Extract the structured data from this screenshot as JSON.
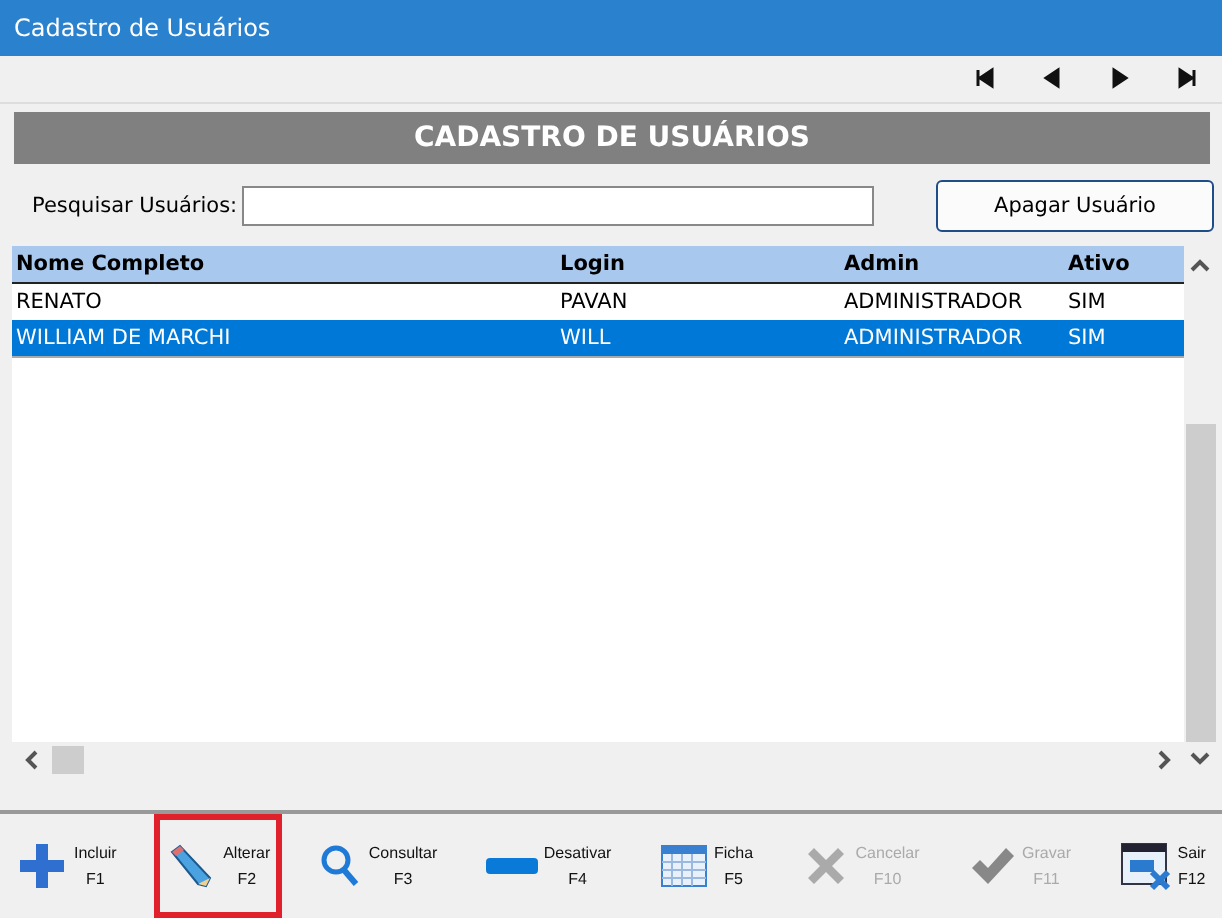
{
  "window": {
    "title": "Cadastro de Usuários"
  },
  "nav_buttons": [
    {
      "kind": "first"
    },
    {
      "kind": "prev"
    },
    {
      "kind": "next"
    },
    {
      "kind": "last"
    }
  ],
  "banner": "CADASTRO DE USUÁRIOS",
  "search": {
    "label": "Pesquisar Usuários:"
  },
  "delete_button": "Apagar Usuário",
  "table": {
    "columns": [
      "Nome Completo",
      "Login",
      "Admin",
      "Ativo"
    ],
    "rows": [
      {
        "cells": [
          "RENATO",
          "PAVAN",
          "ADMINISTRADOR",
          "SIM"
        ],
        "selected": false
      },
      {
        "cells": [
          "WILLIAM DE MARCHI",
          "WILL",
          "ADMINISTRADOR",
          "SIM"
        ],
        "selected": true
      }
    ]
  },
  "toolbar": [
    {
      "kind": "plus",
      "label": "Incluir",
      "key": "F1",
      "disabled": false,
      "highlighted": false
    },
    {
      "kind": "pencil",
      "label": "Alterar",
      "key": "F2",
      "disabled": false,
      "highlighted": true
    },
    {
      "kind": "search",
      "label": "Consultar",
      "key": "F3",
      "disabled": false,
      "highlighted": false
    },
    {
      "kind": "minus",
      "label": "Desativar",
      "key": "F4",
      "disabled": false,
      "highlighted": false
    },
    {
      "kind": "calendar",
      "label": "Ficha",
      "key": "F5",
      "disabled": false,
      "highlighted": false
    },
    {
      "kind": "cross",
      "label": "Cancelar",
      "key": "F10",
      "disabled": true,
      "highlighted": false
    },
    {
      "kind": "check",
      "label": "Gravar",
      "key": "F11",
      "disabled": true,
      "highlighted": false
    },
    {
      "kind": "exit",
      "label": "Sair",
      "key": "F12",
      "disabled": false,
      "highlighted": false
    }
  ]
}
